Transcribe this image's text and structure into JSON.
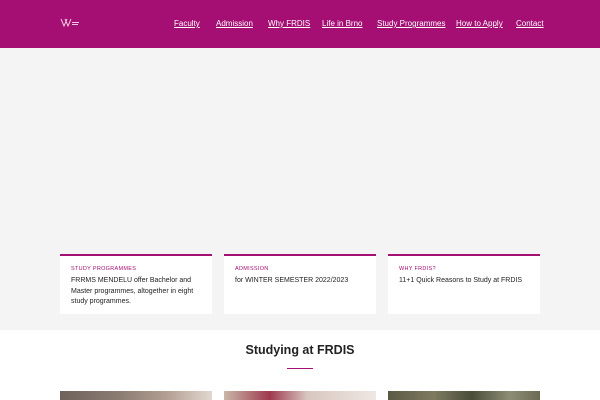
{
  "header": {
    "logo_icon": "faculty-logo-icon",
    "background": "#a50e73",
    "nav": [
      "Faculty",
      "Admission",
      "Why FRDIS",
      "Life in Brno",
      "Study Programmes",
      "How to Apply",
      "Contact"
    ]
  },
  "cards": [
    {
      "kicker": "STUDY PROGRAMMES",
      "text": "FRRMS MENDELU offer Bachelor and Master programmes, altogether in eight study programmes."
    },
    {
      "kicker": "ADMISSION",
      "text": "for WINTER SEMESTER 2022/2023"
    },
    {
      "kicker": "WHY FRDIS?",
      "text": "11+1 Quick Reasons to Study at FRDIS"
    }
  ],
  "section": {
    "title": "Studying at FRDIS"
  },
  "colors": {
    "accent": "#a50e73",
    "hero_bg": "#f4f4f4"
  }
}
